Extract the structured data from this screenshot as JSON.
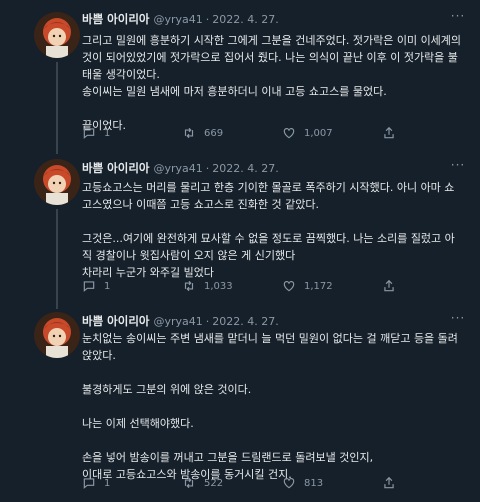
{
  "tweets": [
    {
      "name": "바쁨 아이리아",
      "handle": "@yrya41",
      "date": "2022. 4. 27.",
      "paragraphs": [
        "그리고 밀원에 흥분하기 시작한 그에게 그분을 건네주었다. 젓가락은 이미 이세계의 것이 되어있었기에 젓가락으로 집어서 줬다. 나는 의식이 끝난 이후 이 젓가락을 불태울 생각이었다.",
        "송이씨는 밀원 냄새에 마저 흥분하더니 이내 고등 쇼고스를 물었다.",
        "끝이었다."
      ],
      "replies": "1",
      "retweets": "669",
      "likes": "1,007"
    },
    {
      "name": "바쁨 아이리아",
      "handle": "@yrya41",
      "date": "2022. 4. 27.",
      "paragraphs": [
        "고등쇼고스는 머리를 물리고 한층 기이한 몰골로 폭주하기 시작했다. 아니 아마 쇼고스였으나 이때쯤 고등 쇼고스로 진화한 것 같았다.",
        "그것은...여기에 완전하게 묘사할 수 없을 정도로 끔찍했다. 나는 소리를 질렀고 아직 경찰이나 윗집사람이 오지 않은 게 신기했다\n차라리 누군가 와주길 빌었다"
      ],
      "replies": "1",
      "retweets": "1,033",
      "likes": "1,172"
    },
    {
      "name": "바쁨 아이리아",
      "handle": "@yrya41",
      "date": "2022. 4. 27.",
      "paragraphs": [
        "눈치없는 송이씨는 주변 냄새를 맡더니 늘 먹던 밀원이 없다는 걸 깨닫고 등을 돌려 앉았다.",
        "불경하게도 그분의 위에 앉은 것이다.",
        "나는 이제 선택해야했다.",
        "손을 넣어 밤송이를 꺼내고 그분을 드림랜드로 돌려보낼 것인지,\n이대로 고등쇼고스와 밤송이를 동거시킬 건지."
      ],
      "replies": "1",
      "retweets": "522",
      "likes": "813"
    }
  ],
  "icons": {
    "reply": "comment-icon",
    "retweet": "retweet-icon",
    "like": "heart-icon",
    "share": "share-icon",
    "more": "more-icon"
  },
  "colors": {
    "background": "#15202b",
    "text": "#e7e9ea",
    "muted": "#8b98a5",
    "divider": "#2f3336"
  }
}
